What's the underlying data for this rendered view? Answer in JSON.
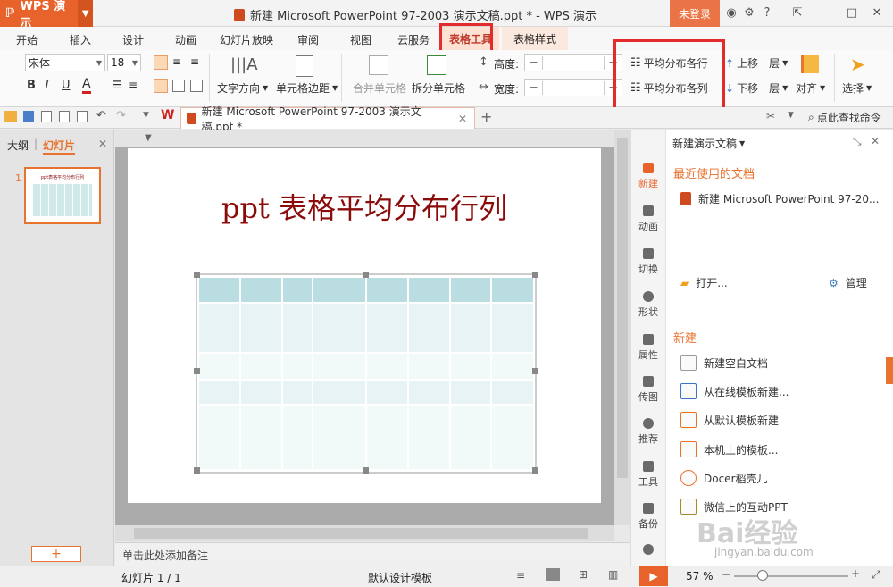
{
  "app": {
    "name": "WPS 演示",
    "doc_title": "新建 Microsoft PowerPoint 97-2003 演示文稿.ppt * - WPS 演示",
    "login": "未登录"
  },
  "menu": [
    "开始",
    "插入",
    "设计",
    "动画",
    "幻灯片放映",
    "审阅",
    "视图",
    "云服务",
    "表格工具",
    "表格样式"
  ],
  "ribbon": {
    "font_name": "宋体",
    "font_size": "18",
    "text_direction": "文字方向",
    "cell_margin": "单元格边距",
    "merge_cells": "合并单元格",
    "split_cells": "拆分单元格",
    "height_label": "高度:",
    "width_label": "宽度:",
    "dist_rows": "平均分布各行",
    "dist_cols": "平均分布各列",
    "bring_forward": "上移一层",
    "send_backward": "下移一层",
    "align": "对齐",
    "select": "选择"
  },
  "quickbar": {
    "doc_tab": "新建 Microsoft PowerPoint 97-2003 演示文稿.ppt *",
    "search": "点此查找命令"
  },
  "leftpanel": {
    "tab_outline": "大纲",
    "tab_slides": "幻灯片",
    "slide_number": "1"
  },
  "slide": {
    "title": "ppt 表格平均分布行列",
    "thumb_title": "ppt表格平均分布行列",
    "notes_placeholder": "单击此处添加备注"
  },
  "sidebar": [
    "新建",
    "动画",
    "切换",
    "形状",
    "属性",
    "传图",
    "推荐",
    "工具",
    "备份"
  ],
  "taskpane": {
    "header": "新建演示文稿",
    "recent_title": "最近使用的文档",
    "recent_item": "新建 Microsoft PowerPoint 97-20...",
    "open": "打开...",
    "manage": "管理",
    "new_title": "新建",
    "new_items": [
      "新建空白文档",
      "从在线模板新建...",
      "从默认模板新建",
      "本机上的模板...",
      "Docer稻壳儿",
      "微信上的互动PPT"
    ]
  },
  "status": {
    "slide_info": "幻灯片 1 / 1",
    "design": "默认设计模板",
    "zoom": "57 %"
  },
  "colors": {
    "accent": "#e8622b",
    "highlight_box": "#e32b2b",
    "title_red": "#8b0a0a",
    "table_header": "#b9dde0",
    "table_body": "#e7f3f4"
  },
  "watermark": {
    "text": "Bai经验",
    "url": "jingyan.baidu.com"
  }
}
